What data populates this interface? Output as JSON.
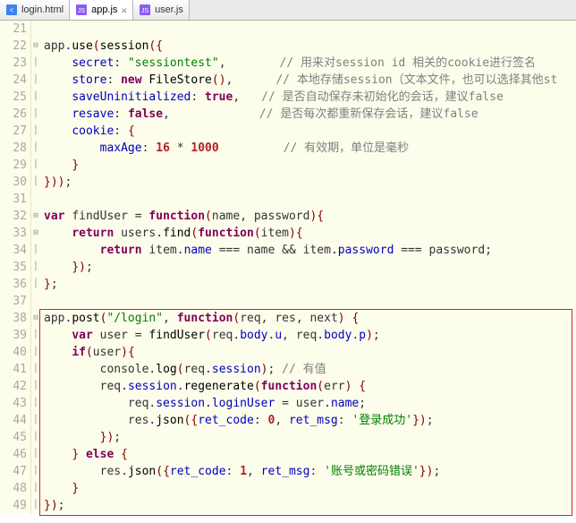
{
  "tabs": [
    {
      "icon": "html",
      "label": "login.html",
      "close": ""
    },
    {
      "icon": "js",
      "label": "app.js",
      "close": "✕"
    },
    {
      "icon": "js",
      "label": "user.js",
      "close": ""
    }
  ],
  "active_tab": 1,
  "first_line": 21,
  "last_line": 49,
  "code": {
    "l22": {
      "a": "app",
      "b": "use",
      "c": "session"
    },
    "l23": {
      "k": "secret",
      "v": "\"sessiontest\"",
      "c": "// 用来对session id 相关的cookie进行签名"
    },
    "l24": {
      "k": "store",
      "v1": "new",
      "v2": "FileStore",
      "c": "// 本地存储session（文本文件，也可以选择其他st"
    },
    "l25": {
      "k": "saveUninitialized",
      "v": "true",
      "c": "// 是否自动保存未初始化的会话，建议false"
    },
    "l26": {
      "k": "resave",
      "v": "false",
      "c": "// 是否每次都重新保存会话，建议false"
    },
    "l27": {
      "k": "cookie"
    },
    "l28": {
      "k": "maxAge",
      "n1": "16",
      "n2": "1000",
      "c": "// 有效期，单位是毫秒"
    },
    "l32": {
      "kw1": "var",
      "id": "findUser",
      "kw2": "function",
      "p1": "name",
      "p2": "password"
    },
    "l33": {
      "kw": "return",
      "a": "users",
      "b": "find",
      "kw2": "function",
      "p": "item"
    },
    "l34": {
      "kw": "return",
      "a": "item",
      "b": "name",
      "op": "===",
      "c": "name",
      "d": "&&",
      "e": "item",
      "f": "password",
      "g": "===",
      "h": "password"
    },
    "l38": {
      "a": "app",
      "b": "post",
      "s": "\"/login\"",
      "kw": "function",
      "p1": "req",
      "p2": "res",
      "p3": "next"
    },
    "l39": {
      "kw": "var",
      "id": "user",
      "fn": "findUser",
      "a": "req",
      "b": "body",
      "c": "u",
      "d": "req",
      "e": "body",
      "f": "p"
    },
    "l40": {
      "kw": "if",
      "id": "user"
    },
    "l41": {
      "a": "console",
      "b": "log",
      "c": "req",
      "d": "session",
      "cm": "// 有值"
    },
    "l42": {
      "a": "req",
      "b": "session",
      "c": "regenerate",
      "kw": "function",
      "p": "err"
    },
    "l43": {
      "a": "req",
      "b": "session",
      "c": "loginUser",
      "d": "user",
      "e": "name"
    },
    "l44": {
      "a": "res",
      "b": "json",
      "k1": "ret_code",
      "v1": "0",
      "k2": "ret_msg",
      "v2": "'登录成功'"
    },
    "l46": {
      "kw": "else"
    },
    "l47": {
      "a": "res",
      "b": "json",
      "k1": "ret_code",
      "v1": "1",
      "k2": "ret_msg",
      "v2": "'账号或密码错误'"
    }
  },
  "fold_markers": {
    "22": "⊟",
    "23": "│",
    "24": "│",
    "25": "│",
    "26": "│",
    "27": "│",
    "28": "│",
    "29": "│",
    "30": "│",
    "32": "⊟",
    "33": "⊟",
    "34": "│",
    "35": "│",
    "36": "│",
    "38": "⊟",
    "39": "│",
    "40": "│",
    "41": "│",
    "42": "│",
    "43": "│",
    "44": "│",
    "45": "│",
    "46": "│",
    "47": "│",
    "48": "│",
    "49": "│"
  }
}
